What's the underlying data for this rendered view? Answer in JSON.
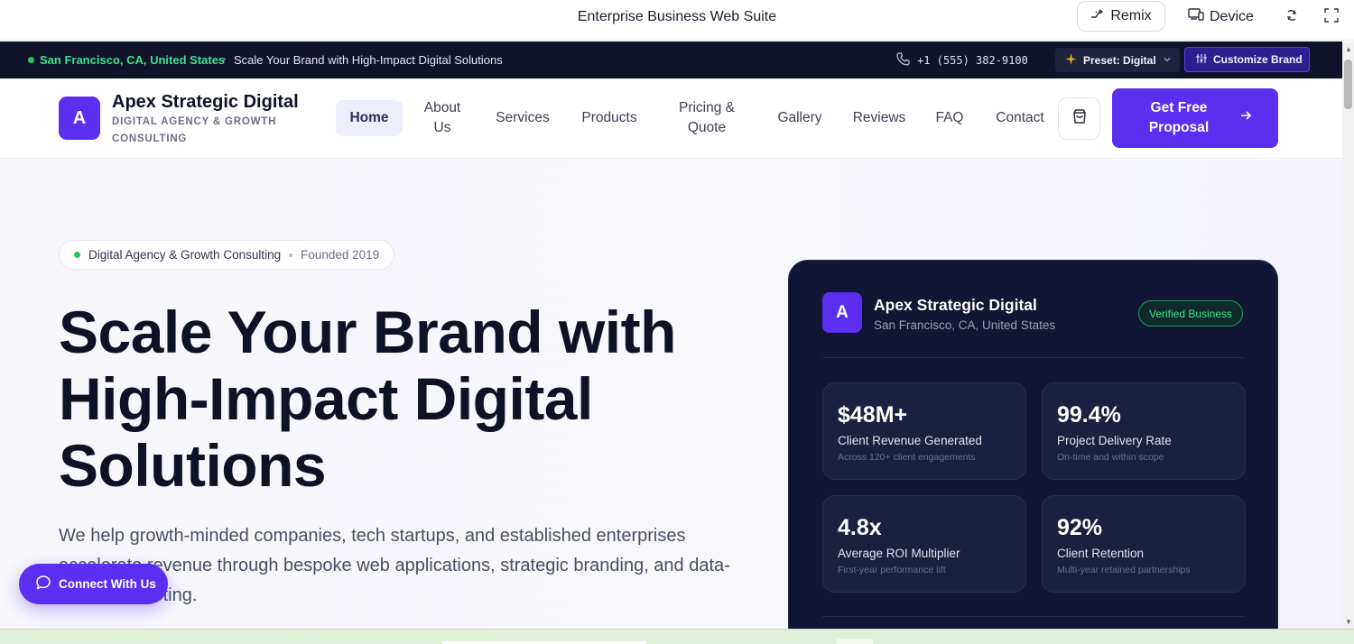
{
  "chrome": {
    "title": "Enterprise Business Web Suite",
    "remix_label": "Remix",
    "device_label": "Device"
  },
  "topbar": {
    "location": "San Francisco, CA, United States",
    "separator": "•",
    "tagline": "Scale Your Brand with High-Impact Digital Solutions",
    "phone": "+1 (555) 382-9100",
    "preset_label": "Preset: Digital",
    "customize_label": "Customize Brand"
  },
  "nav": {
    "logo_letter": "A",
    "brand_name": "Apex Strategic Digital",
    "brand_sub": "DIGITAL AGENCY & GROWTH CONSULTING",
    "items": [
      "Home",
      "About Us",
      "Services",
      "Products",
      "Pricing & Quote",
      "Gallery",
      "Reviews",
      "FAQ",
      "Contact"
    ],
    "cta_label": "Get Free Proposal"
  },
  "hero": {
    "pill_main": "Digital Agency & Growth Consulting",
    "pill_founded": "Founded 2019",
    "headline": "Scale Your Brand with High-Impact Digital Solutions",
    "description": "We help growth-minded companies, tech startups, and established enterprises accelerate revenue through bespoke web applications, strategic branding, and data-driven marketing."
  },
  "card": {
    "logo_letter": "A",
    "name": "Apex Strategic Digital",
    "location": "San Francisco, CA, United States",
    "badge": "Verified Business",
    "stats": [
      {
        "value": "$48M+",
        "label": "Client Revenue Generated",
        "sub": "Across 120+ client engagements"
      },
      {
        "value": "99.4%",
        "label": "Project Delivery Rate",
        "sub": "On-time and within scope"
      },
      {
        "value": "4.8x",
        "label": "Average ROI Multiplier",
        "sub": "First-year performance lift"
      },
      {
        "value": "92%",
        "label": "Client Retention",
        "sub": "Multi-year retained partnerships"
      }
    ]
  },
  "connect": {
    "label": "Connect With Us"
  },
  "colors": {
    "brand": "#5b2ff0",
    "dark": "#10132a",
    "success": "#22c55e"
  }
}
